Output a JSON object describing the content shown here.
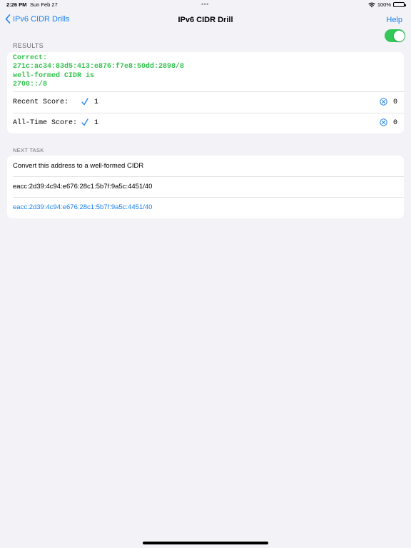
{
  "status_bar": {
    "time": "2:26 PM",
    "date": "Sun Feb 27",
    "multitask_dots": "•••",
    "battery": "100%"
  },
  "nav": {
    "back_label": "IPv6 CIDR Drills",
    "title": "IPv6 CIDR Drill",
    "help_label": "Help",
    "toggle_on": true
  },
  "results": {
    "header": "RESULTS",
    "message": "Correct:\n271c:ac34:83d5:413:e876:f7e8:50dd:2898/8\nwell-formed CIDR is\n2700::/8",
    "recent": {
      "label": "Recent Score:",
      "correct": "1",
      "wrong": "0"
    },
    "all_time": {
      "label": "All-Time Score:",
      "correct": "1",
      "wrong": "0"
    }
  },
  "next_task": {
    "header": "NEXT TASK",
    "instruction": "Convert this address to a well-formed CIDR",
    "address": "eacc:2d39:4c94:e676:28c1:5b7f:9a5c:4451/40",
    "answer_value": "eacc:2d39:4c94:e676:28c1:5b7f:9a5c:4451/40"
  },
  "colors": {
    "accent": "#1a82f0",
    "success": "#33c24d",
    "toggle": "#34c759",
    "background": "#f2f2f7"
  },
  "icons": [
    "wifi-icon",
    "battery-icon",
    "chevron-left-icon",
    "check-icon",
    "xmark-icon"
  ]
}
